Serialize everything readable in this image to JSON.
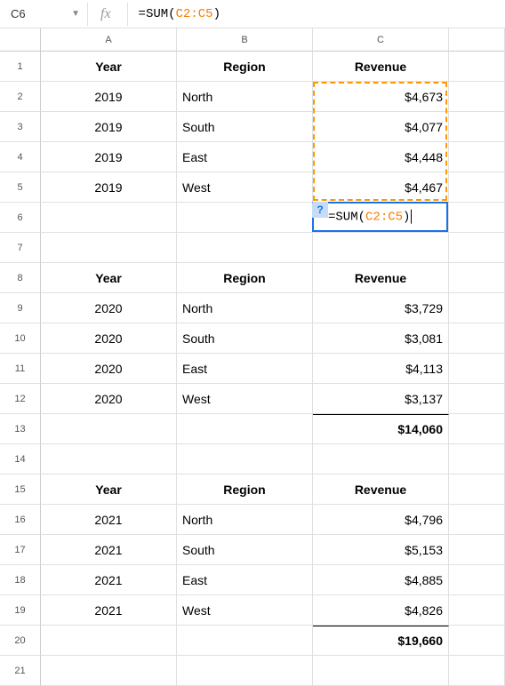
{
  "nameBox": "C6",
  "fxLabel": "fx",
  "formula": {
    "eq": "=",
    "fn": "SUM",
    "open": "(",
    "range": "C2:C5",
    "close": ")"
  },
  "columns": [
    "A",
    "B",
    "C"
  ],
  "rowNumbers": [
    "1",
    "2",
    "3",
    "4",
    "5",
    "6",
    "7",
    "8",
    "9",
    "10",
    "11",
    "12",
    "13",
    "14",
    "15",
    "16",
    "17",
    "18",
    "19",
    "20",
    "21"
  ],
  "rows": [
    {
      "a": "Year",
      "b": "Region",
      "c": "Revenue",
      "header": true
    },
    {
      "a": "2019",
      "b": "North",
      "c": "$4,673"
    },
    {
      "a": "2019",
      "b": "South",
      "c": "$4,077"
    },
    {
      "a": "2019",
      "b": "East",
      "c": "$4,448"
    },
    {
      "a": "2019",
      "b": "West",
      "c": "$4,467"
    },
    {
      "a": "",
      "b": "",
      "c": "",
      "formula": true
    },
    {
      "a": "",
      "b": "",
      "c": ""
    },
    {
      "a": "Year",
      "b": "Region",
      "c": "Revenue",
      "header": true
    },
    {
      "a": "2020",
      "b": "North",
      "c": "$3,729"
    },
    {
      "a": "2020",
      "b": "South",
      "c": "$3,081"
    },
    {
      "a": "2020",
      "b": "East",
      "c": "$4,113"
    },
    {
      "a": "2020",
      "b": "West",
      "c": "$3,137"
    },
    {
      "a": "",
      "b": "",
      "c": "$14,060",
      "total": true
    },
    {
      "a": "",
      "b": "",
      "c": ""
    },
    {
      "a": "Year",
      "b": "Region",
      "c": "Revenue",
      "header": true
    },
    {
      "a": "2021",
      "b": "North",
      "c": "$4,796"
    },
    {
      "a": "2021",
      "b": "South",
      "c": "$5,153"
    },
    {
      "a": "2021",
      "b": "East",
      "c": "$4,885"
    },
    {
      "a": "2021",
      "b": "West",
      "c": "$4,826"
    },
    {
      "a": "",
      "b": "",
      "c": "$19,660",
      "total": true
    },
    {
      "a": "",
      "b": "",
      "c": ""
    }
  ],
  "helpBadge": "?",
  "chart_data": {
    "type": "table",
    "tables": [
      {
        "columns": [
          "Year",
          "Region",
          "Revenue"
        ],
        "rows": [
          [
            "2019",
            "North",
            4673
          ],
          [
            "2019",
            "South",
            4077
          ],
          [
            "2019",
            "East",
            4448
          ],
          [
            "2019",
            "West",
            4467
          ]
        ],
        "total": null
      },
      {
        "columns": [
          "Year",
          "Region",
          "Revenue"
        ],
        "rows": [
          [
            "2020",
            "North",
            3729
          ],
          [
            "2020",
            "South",
            3081
          ],
          [
            "2020",
            "East",
            4113
          ],
          [
            "2020",
            "West",
            3137
          ]
        ],
        "total": 14060
      },
      {
        "columns": [
          "Year",
          "Region",
          "Revenue"
        ],
        "rows": [
          [
            "2021",
            "North",
            4796
          ],
          [
            "2021",
            "South",
            5153
          ],
          [
            "2021",
            "East",
            4885
          ],
          [
            "2021",
            "West",
            4826
          ]
        ],
        "total": 19660
      }
    ]
  }
}
